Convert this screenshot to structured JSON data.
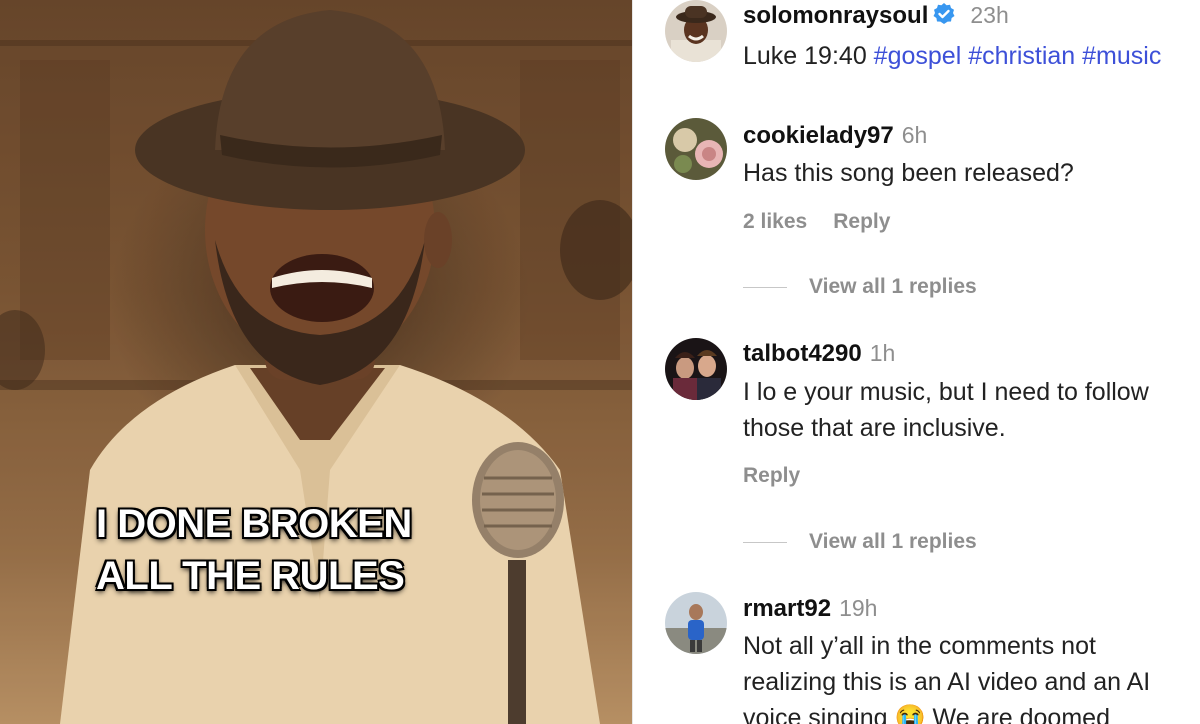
{
  "video": {
    "caption_line1": "I DONE BROKEN",
    "caption_line2": "ALL THE RULES"
  },
  "post": {
    "username": "solomonraysoul",
    "time": "23h",
    "text": "Luke 19:40",
    "hashtags": [
      "#gospel",
      "#christian",
      "#music"
    ],
    "verified": true
  },
  "comments": [
    {
      "username": "cookielady97",
      "time": "6h",
      "text_lines": [
        "Has this song been released?"
      ],
      "likes": "2 likes",
      "reply": "Reply",
      "view_replies": "View all 1 replies"
    },
    {
      "username": "talbot4290",
      "time": "1h",
      "text_lines": [
        "I lo e your music, but I need to follow",
        "those that are inclusive."
      ],
      "reply": "Reply",
      "view_replies": "View all 1 replies"
    },
    {
      "username": "rmart92",
      "time": "19h",
      "text_lines": [
        "Not all y’all in the comments not",
        "realizing this is an AI video and an AI",
        "voice singing 😭 We are doomed"
      ]
    }
  ],
  "colors": {
    "hashtag": "#3d50d8",
    "verified_badge": "#3897f0",
    "muted_text": "#8e8e8e"
  }
}
